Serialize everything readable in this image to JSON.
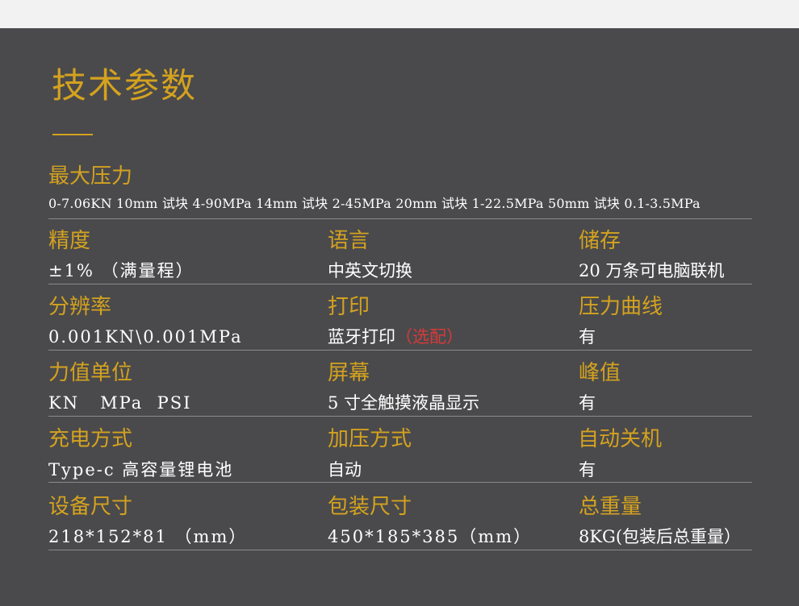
{
  "title": "技术参数",
  "max_force": {
    "label": "最大压力",
    "value": "0-7.06KN 10mm 试块 4-90MPa  14mm 试块 2-45MPa 20mm 试块 1-22.5MPa  50mm 试块 0.1-3.5MPa"
  },
  "rows": [
    [
      {
        "label": "精度",
        "value": "±1% （满量程）"
      },
      {
        "label": "语言",
        "value": "中英文切换"
      },
      {
        "label": "储存",
        "value": "20 万条可电脑联机"
      }
    ],
    [
      {
        "label": "分辨率",
        "value": "0.001KN\\0.001MPa"
      },
      {
        "label": "打印",
        "value": "蓝牙打印",
        "extra": "（选配）"
      },
      {
        "label": "压力曲线",
        "value": "有"
      }
    ],
    [
      {
        "label": "力值单位",
        "value": "KN   MPa  PSI"
      },
      {
        "label": "屏幕",
        "value": "5 寸全触摸液晶显示"
      },
      {
        "label": "峰值",
        "value": "有"
      }
    ],
    [
      {
        "label": "充电方式",
        "value": "Type-c 高容量锂电池"
      },
      {
        "label": "加压方式",
        "value": "自动"
      },
      {
        "label": "自动关机",
        "value": "有"
      }
    ],
    [
      {
        "label": "设备尺寸",
        "value": "218*152*81 （mm）"
      },
      {
        "label": "包装尺寸",
        "value": "450*185*385（mm）"
      },
      {
        "label": "总重量",
        "value": "8KG(包装后总重量）"
      }
    ]
  ],
  "colors": {
    "accent": "#d4a21f",
    "background": "#4a4a4c",
    "text": "#ffffff",
    "highlight": "#d63a3a"
  }
}
